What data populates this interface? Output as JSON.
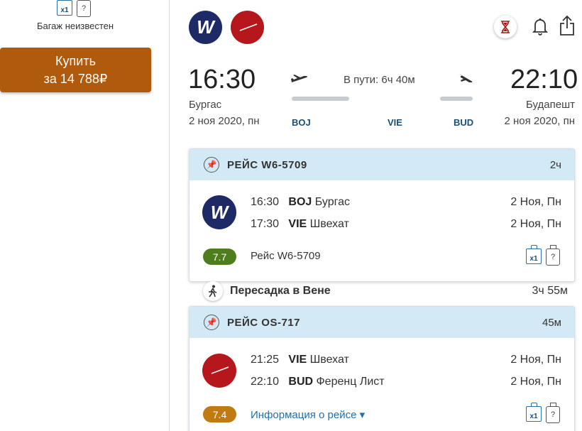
{
  "left": {
    "bag_small_label": "x1",
    "bag_unknown_mark": "?",
    "baggage_status": "Багаж неизвестен",
    "buy_line1": "Купить",
    "buy_line2": "за 14 788₽"
  },
  "header": {
    "airline1_letter": "W",
    "icons": [
      "hourglass-icon",
      "bell-icon",
      "share-icon"
    ]
  },
  "trip": {
    "depart_time": "16:30",
    "depart_city": "Бургас",
    "depart_date": "2 ноя 2020, пн",
    "arrive_time": "22:10",
    "arrive_city": "Будапешт",
    "arrive_date": "2 ноя 2020, пн",
    "duration": "В пути: 6ч 40м",
    "codes": [
      "BOJ",
      "VIE",
      "BUD"
    ]
  },
  "segments": [
    {
      "flight": "РЕЙС W6-5709",
      "duration": "2ч",
      "dep_time": "16:30",
      "dep_code": "BOJ",
      "dep_city": "Бургас",
      "dep_date": "2 Ноя, Пн",
      "arr_time": "17:30",
      "arr_code": "VIE",
      "arr_city": "Швехат",
      "arr_date": "2 Ноя, Пн",
      "score": "7.7",
      "detail": "Рейс W6-5709"
    },
    {
      "flight": "РЕЙС OS-717",
      "duration": "45м",
      "dep_time": "21:25",
      "dep_code": "VIE",
      "dep_city": "Швехат",
      "dep_date": "2 Ноя, Пн",
      "arr_time": "22:10",
      "arr_code": "BUD",
      "arr_city": "Ференц Лист",
      "arr_date": "2 Ноя, Пн",
      "score": "7.4",
      "detail": "Информация о рейсе ▾"
    }
  ],
  "transfer": {
    "label": "Пересадка в Вене",
    "duration": "3ч 55м"
  },
  "colors": {
    "buy_button": "#b05a0e",
    "card_header": "#d3eaf6",
    "score_green": "#4e7d1e",
    "score_orange": "#c07a12",
    "link": "#1f6fab",
    "airline1": "#1d2a66",
    "airline2": "#b5171d"
  }
}
